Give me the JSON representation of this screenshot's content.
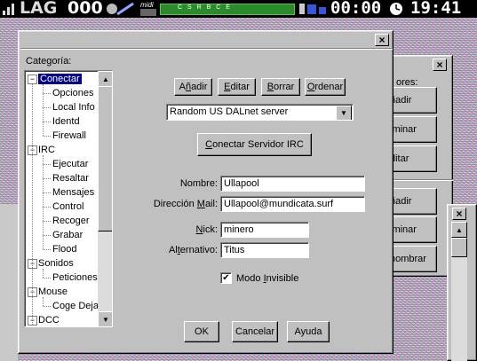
{
  "statusbar": {
    "brand": "LAG",
    "lag_value": "000",
    "meter_label": "midi",
    "meter_codes": "C S R B C E",
    "counter": "00:00",
    "clock": "19:41"
  },
  "dialog": {
    "close_glyph": "×",
    "tree_title": "Categoría:",
    "tree": [
      {
        "label": "Conectar",
        "level": 0,
        "expander": "−",
        "selected": true
      },
      {
        "label": "Opciones",
        "level": 1
      },
      {
        "label": "Local Info",
        "level": 1
      },
      {
        "label": "Identd",
        "level": 1
      },
      {
        "label": "Firewall",
        "level": 1
      },
      {
        "label": "IRC",
        "level": 0,
        "expander": "−"
      },
      {
        "label": "Ejecutar",
        "level": 1
      },
      {
        "label": "Resaltar",
        "level": 1
      },
      {
        "label": "Mensajes",
        "level": 1
      },
      {
        "label": "Control",
        "level": 1
      },
      {
        "label": "Recoger",
        "level": 1
      },
      {
        "label": "Grabar",
        "level": 1
      },
      {
        "label": "Flood",
        "level": 1
      },
      {
        "label": "Sonidos",
        "level": 0,
        "expander": "−"
      },
      {
        "label": "Peticiones",
        "level": 1
      },
      {
        "label": "Mouse",
        "level": 0,
        "expander": "−"
      },
      {
        "label": "Coge Deja",
        "level": 1
      },
      {
        "label": "DCC",
        "level": 0,
        "expander": "−"
      }
    ],
    "server_buttons": {
      "add": {
        "pre": "A",
        "u": "ñ",
        "post": "adir"
      },
      "edit": {
        "pre": "",
        "u": "E",
        "post": "ditar"
      },
      "delete": {
        "pre": "",
        "u": "B",
        "post": "orrar"
      },
      "sort": {
        "pre": "",
        "u": "O",
        "post": "rdenar"
      }
    },
    "server_select": "Random US DALnet server",
    "connect_button": {
      "pre": "",
      "u": "C",
      "post": "onectar Servidor IRC"
    },
    "fields": {
      "name_label": "Nombre:",
      "name_value": "Ullapool",
      "email_label": {
        "pre": "Dirección ",
        "u": "M",
        "post": "ail:"
      },
      "email_value": "Ullapool@mundicata.surf",
      "nick_label": {
        "pre": "",
        "u": "N",
        "post": "ick:"
      },
      "nick_value": "minero",
      "alt_label": {
        "pre": "Al",
        "u": "t",
        "post": "ernativo:"
      },
      "alt_value": "Titus"
    },
    "invisible": {
      "checked": true,
      "check_glyph": "✔",
      "label_pre": "Modo ",
      "label_u": "I",
      "label_post": "nvisible"
    },
    "footer": {
      "ok": "OK",
      "cancel": "Cancelar",
      "help": "Ayuda"
    }
  },
  "background_window": {
    "close_glyph": "×",
    "group_label": "ores:",
    "buttons_top": [
      "ñadir",
      "iminar",
      "ditar"
    ],
    "buttons_bottom": [
      "ñadir",
      "iminar",
      "nombrar"
    ],
    "close2_glyph": "×"
  },
  "colors": {
    "selection": "#000080",
    "face": "#c0c0c0",
    "meter": "#2b8a2b"
  }
}
